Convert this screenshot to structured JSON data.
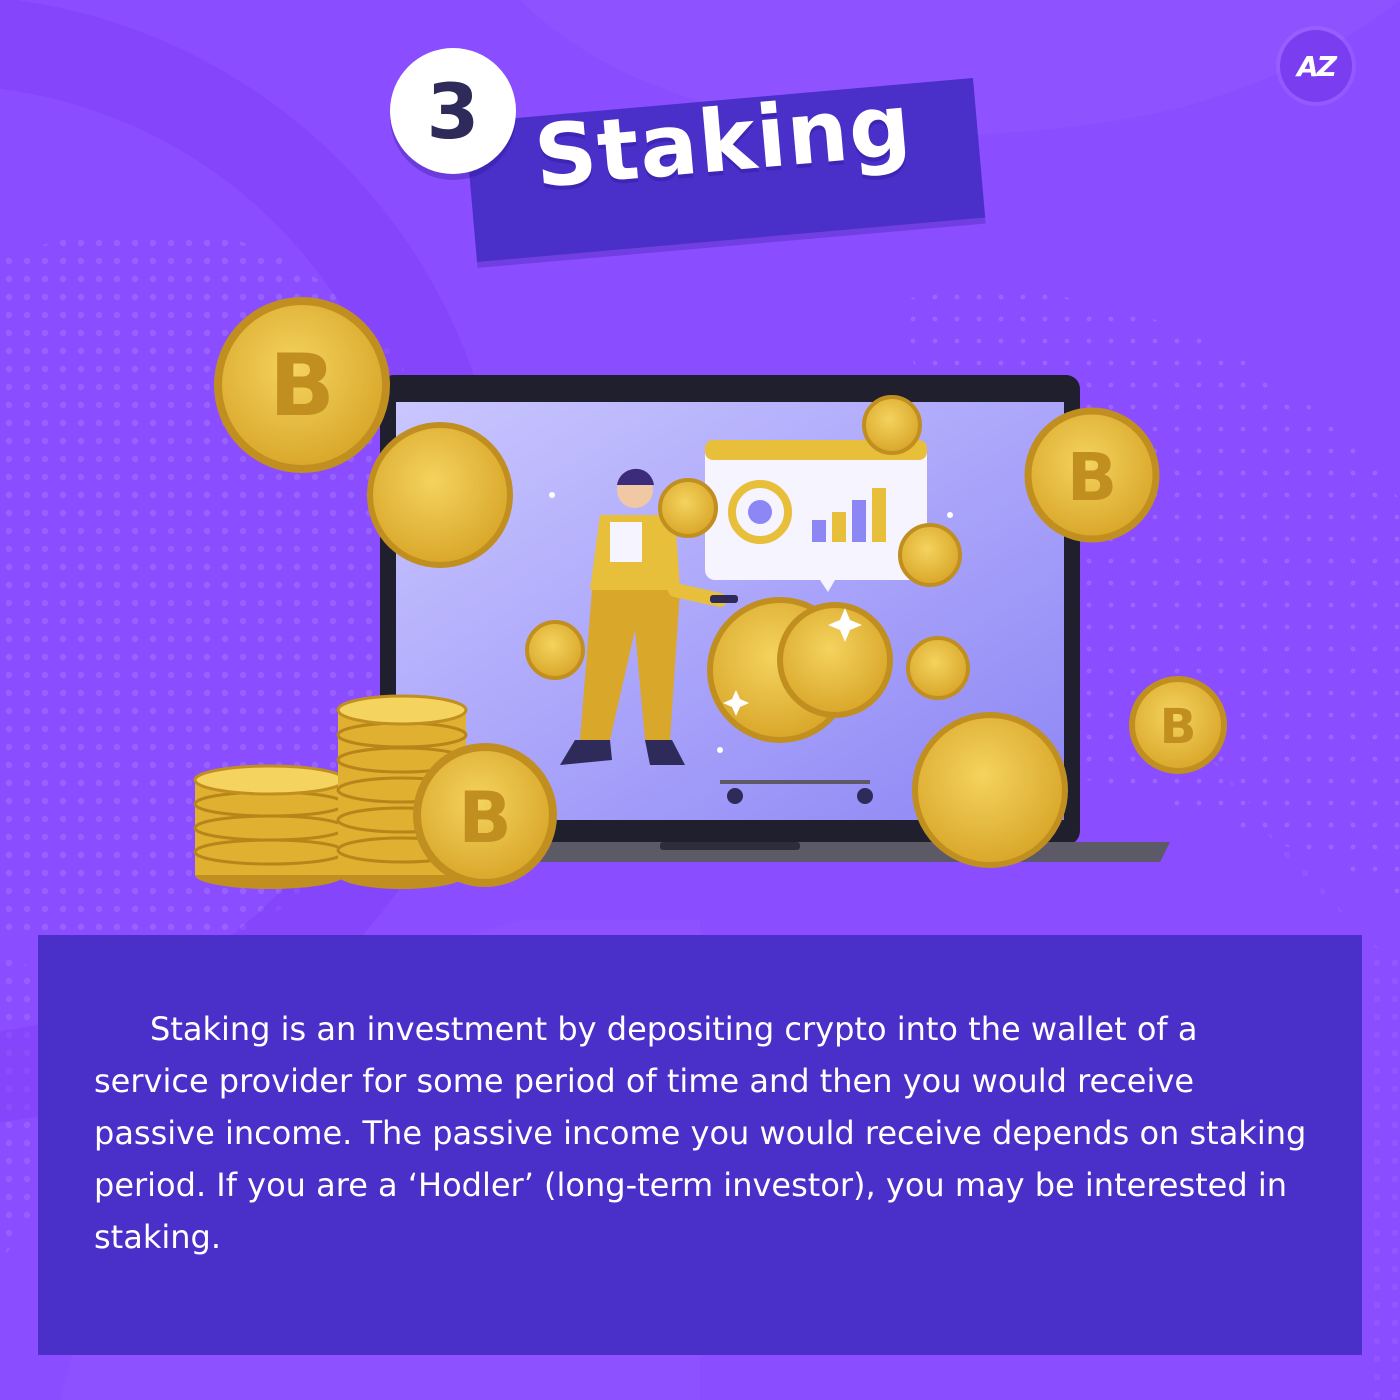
{
  "brand": {
    "logo_text": "AZ"
  },
  "header": {
    "step_number": "3",
    "title": "Staking"
  },
  "illustration": {
    "coin_symbol": "B"
  },
  "description": {
    "text": "Staking is an investment by depositing crypto into the wallet of a service provider for some period of time and then you would receive passive income.  The passive income you would receive depends on staking period.  If you are a ‘Hodler’ (long-term investor), you may be interested in staking."
  },
  "colors": {
    "background": "#8a4dff",
    "panel": "#4a2fc9",
    "coin": "#e8bf3a",
    "text": "#ffffff"
  }
}
